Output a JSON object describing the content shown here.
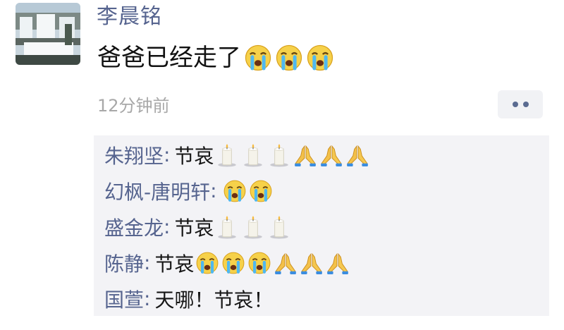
{
  "post": {
    "author": "李晨铭",
    "text": "爸爸已经走了",
    "text_emojis": [
      "cry",
      "cry",
      "cry"
    ],
    "timestamp": "12分钟前"
  },
  "comments": [
    {
      "name": "朱翔坚",
      "text": "节哀",
      "emojis": [
        "candle",
        "candle",
        "candle",
        "pray",
        "pray",
        "pray"
      ]
    },
    {
      "name": "幻枫-唐明轩",
      "text": "",
      "emojis": [
        "cry",
        "cry"
      ]
    },
    {
      "name": "盛金龙",
      "text": "节哀",
      "emojis": [
        "candle",
        "candle",
        "candle"
      ]
    },
    {
      "name": "陈静",
      "text": "节哀",
      "emojis": [
        "cry",
        "cry",
        "cry",
        "pray",
        "pray",
        "pray"
      ]
    },
    {
      "name": "国萱",
      "text": "天哪！节哀！",
      "emojis": []
    }
  ],
  "colors": {
    "name": "#56648f",
    "text": "#111111",
    "timestamp": "#a8a8a8",
    "comment_bg": "#f3f3f6"
  },
  "icons": {
    "avatar": "waterfall-avatar",
    "more": "more-dots-icon",
    "cry": "crying-face-emoji",
    "candle": "candle-emoji",
    "pray": "folded-hands-emoji"
  }
}
